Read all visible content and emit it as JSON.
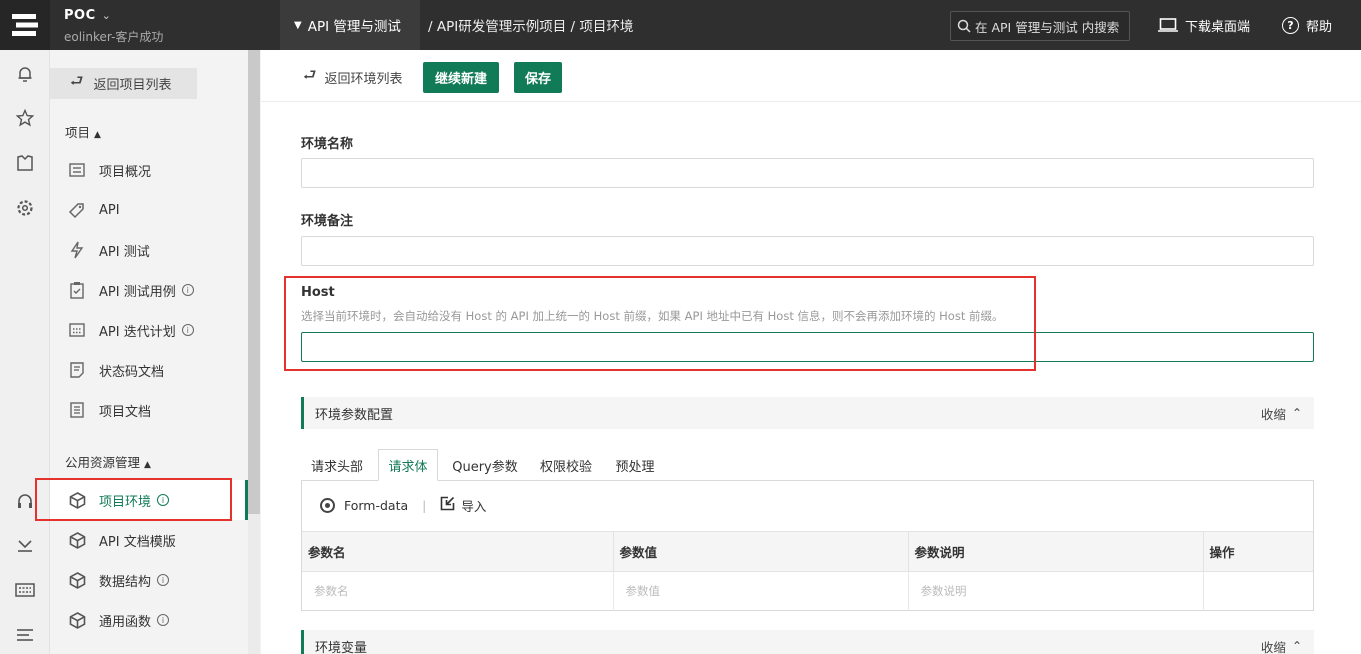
{
  "topbar": {
    "project_name": "POC",
    "project_sub": "eolinker-客户成功",
    "module": "API 管理与测试",
    "breadcrumb": "/ API研发管理示例项目 / 项目环境",
    "search_placeholder": "在 API 管理与测试 内搜索",
    "download": "下载桌面端",
    "help": "帮助"
  },
  "nav": {
    "back": "返回项目列表",
    "group_project": "项目",
    "group_public": "公用资源管理",
    "items": [
      {
        "label": "项目概况",
        "icon": "overview-icon"
      },
      {
        "label": "API",
        "icon": "api-tag-icon"
      },
      {
        "label": "API 测试",
        "icon": "lightning-icon"
      },
      {
        "label": "API 测试用例",
        "icon": "clipboard-check-icon",
        "info": true
      },
      {
        "label": "API 迭代计划",
        "icon": "calendar-icon",
        "info": true
      },
      {
        "label": "状态码文档",
        "icon": "status-doc-icon"
      },
      {
        "label": "项目文档",
        "icon": "doc-icon"
      }
    ],
    "public_items": [
      {
        "label": "项目环境",
        "icon": "cube-icon",
        "info": true,
        "active": true
      },
      {
        "label": "API 文档模版",
        "icon": "cube-icon"
      },
      {
        "label": "数据结构",
        "icon": "cube-icon",
        "info": true
      },
      {
        "label": "通用函数",
        "icon": "cube-icon",
        "info": true
      }
    ]
  },
  "toolbar": {
    "back": "返回环境列表",
    "new_continue": "继续新建",
    "save": "保存"
  },
  "form": {
    "env_name_label": "环境名称",
    "env_note_label": "环境备注",
    "host_label": "Host",
    "host_hint": "选择当前环境时，会自动给没有 Host 的 API 加上统一的 Host 前缀，如果 API 地址中已有 Host 信息，则不会再添加环境的 Host 前缀。"
  },
  "params_section": {
    "title": "环境参数配置",
    "collapse": "收缩",
    "tabs": [
      "请求头部",
      "请求体",
      "Query参数",
      "权限校验",
      "预处理"
    ],
    "active_tab": "请求体",
    "body_type": "Form-data",
    "import": "导入",
    "columns": [
      "参数名",
      "参数值",
      "参数说明",
      "操作"
    ],
    "row_placeholders": [
      "参数名",
      "参数值",
      "参数说明",
      ""
    ]
  },
  "vars_section": {
    "title": "环境变量",
    "collapse": "收缩"
  },
  "colors": {
    "brand_green": "#117a56",
    "annotation_red": "#e5322d",
    "topbar": "#2f2f2f"
  }
}
